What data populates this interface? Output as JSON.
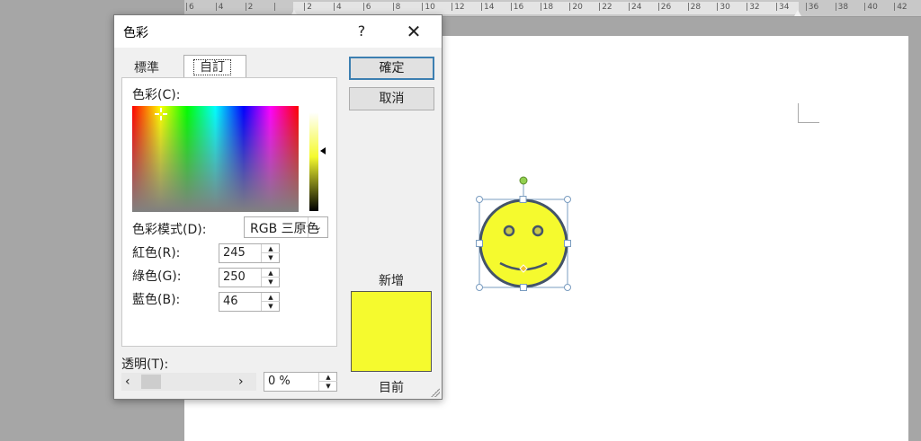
{
  "ruler": {
    "ticks": [
      "6",
      "4",
      "2",
      "",
      "2",
      "4",
      "6",
      "8",
      "10",
      "12",
      "14",
      "16",
      "18",
      "20",
      "22",
      "24",
      "26",
      "28",
      "30",
      "32",
      "34",
      "36",
      "38",
      "40",
      "42"
    ]
  },
  "dialog": {
    "title": "色彩",
    "help": "?",
    "close": "✕",
    "tabs": [
      "標準",
      "自訂"
    ],
    "active_tab": 1,
    "colors_label": "色彩(C):",
    "model_label": "色彩模式(D):",
    "model_value": "RGB 三原色",
    "red_label": "紅色(R):",
    "red_value": "245",
    "green_label": "綠色(G):",
    "green_value": "250",
    "blue_label": "藍色(B):",
    "blue_value": "46",
    "ok_label": "確定",
    "cancel_label": "取消",
    "new_label": "新增",
    "current_label": "目前",
    "transparency_label": "透明(T):",
    "transparency_value": "0 %",
    "selected_color": "#f5fa2e"
  },
  "shape": {
    "name": "smiley-face",
    "fill": "#f5fa2e",
    "outline": "#44546a"
  },
  "icons": {
    "dropdown": "chevron-down-icon",
    "spin_up": "triangle-up-icon",
    "spin_down": "triangle-down-icon",
    "scroll_left": "chevron-left-icon",
    "scroll_right": "chevron-right-icon",
    "close": "close-icon"
  }
}
